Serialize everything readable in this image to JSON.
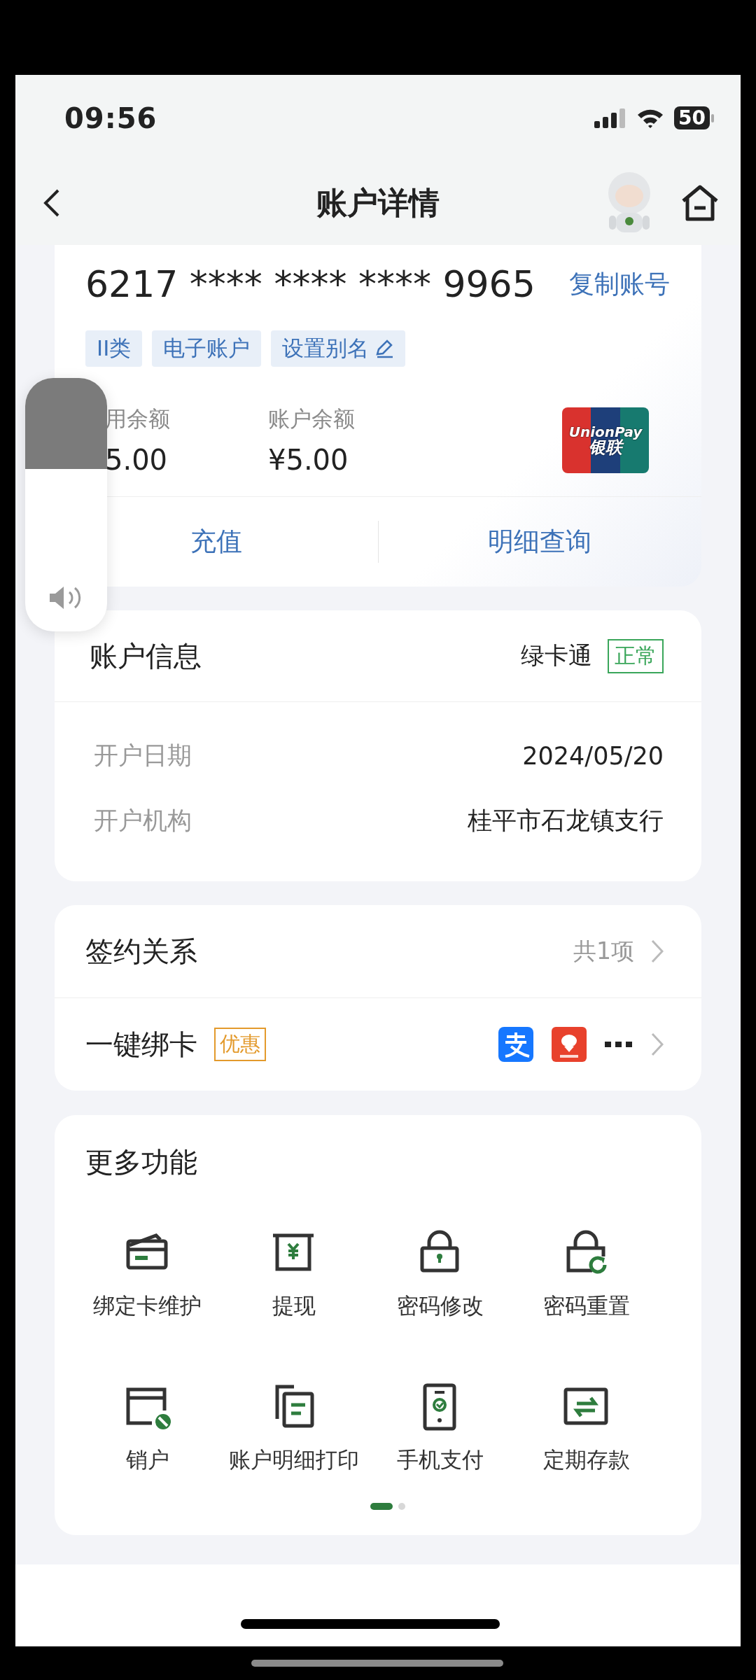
{
  "status_bar": {
    "time": "09:56",
    "battery": "50"
  },
  "nav": {
    "title": "账户详情"
  },
  "card": {
    "number": "6217 **** **** **** 9965",
    "copy_button": "复制账号",
    "tags": [
      {
        "label": "II类",
        "kind": "plain"
      },
      {
        "label": "电子账户",
        "kind": "plain"
      },
      {
        "label": "设置别名",
        "kind": "edit"
      }
    ],
    "balances": [
      {
        "label": "用余额",
        "amount": "5.00"
      },
      {
        "label": "账户余额",
        "amount": "¥5.00"
      }
    ],
    "logo": {
      "latin": "UnionPay",
      "chinese": "银联"
    },
    "actions": [
      "充值",
      "明细查询"
    ]
  },
  "account_info": {
    "title": "账户信息",
    "card_type": "绿卡通",
    "status": "正常",
    "rows": [
      {
        "label": "开户日期",
        "value": "2024/05/20"
      },
      {
        "label": "开户机构",
        "value": "桂平市石龙镇支行"
      }
    ]
  },
  "signing": {
    "title": "签约关系",
    "count": "共1项",
    "bind_label": "一键绑卡",
    "badge": "优惠"
  },
  "more_functions": {
    "title": "更多功能",
    "items": [
      {
        "label": "绑定卡维护",
        "kind": "card"
      },
      {
        "label": "提现",
        "kind": "withdraw"
      },
      {
        "label": "密码修改",
        "kind": "lock"
      },
      {
        "label": "密码重置",
        "kind": "lockreset"
      },
      {
        "label": "销户",
        "kind": "cancel"
      },
      {
        "label": "账户明细打印",
        "kind": "documents"
      },
      {
        "label": "手机支付",
        "kind": "phone"
      },
      {
        "label": "定期存款",
        "kind": "transfer"
      }
    ],
    "pages": [
      {
        "selected": true
      },
      {
        "selected": false
      }
    ]
  }
}
